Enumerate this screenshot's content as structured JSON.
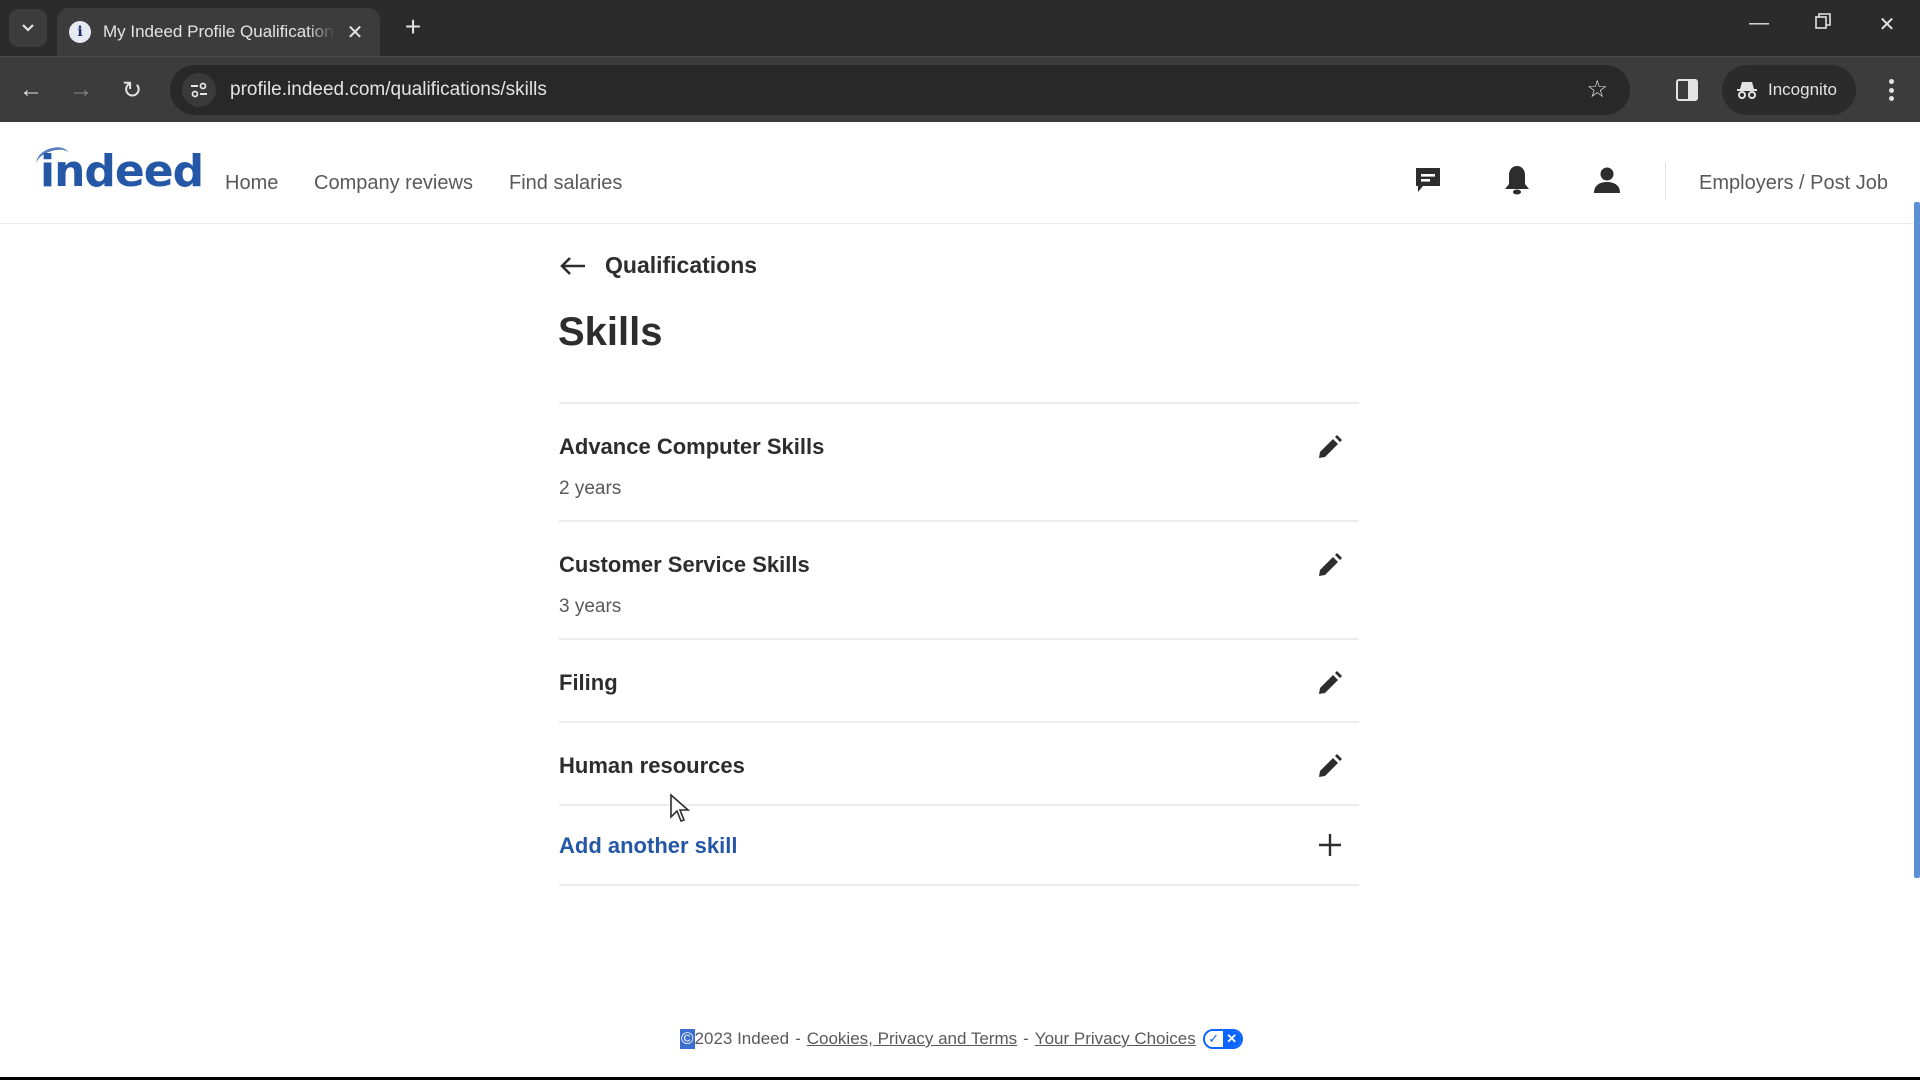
{
  "browser": {
    "tab_title": "My Indeed Profile Qualifications",
    "url": "profile.indeed.com/qualifications/skills",
    "incognito_label": "Incognito"
  },
  "header": {
    "logo_text": "indeed",
    "nav": [
      {
        "label": "Home"
      },
      {
        "label": "Company reviews"
      },
      {
        "label": "Find salaries"
      }
    ],
    "icons": [
      "messages-icon",
      "notifications-bell-icon",
      "profile-person-icon"
    ],
    "employers_link": "Employers / Post Job",
    "brand_color": "#2557a7"
  },
  "page": {
    "back_label": "Qualifications",
    "title": "Skills",
    "skills": [
      {
        "name": "Advance Computer Skills",
        "years": "2 years"
      },
      {
        "name": "Customer Service Skills",
        "years": "3 years"
      },
      {
        "name": "Filing",
        "years": ""
      },
      {
        "name": "Human resources",
        "years": ""
      }
    ],
    "add_label": "Add another skill"
  },
  "footer": {
    "copyright_symbol": "©",
    "copyright_text": "2023 Indeed",
    "separator": "-",
    "cookies_link": "Cookies, Privacy and Terms",
    "privacy_choices_link": "Your Privacy Choices",
    "toggle_on_glyph": "✓",
    "toggle_off_glyph": "✕"
  }
}
